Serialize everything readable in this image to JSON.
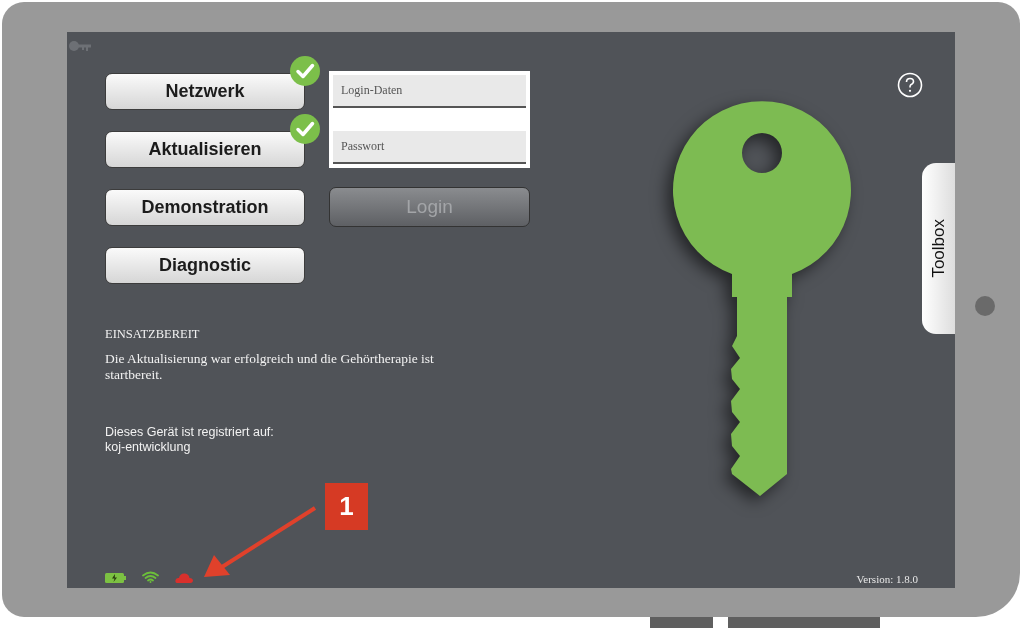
{
  "menu_buttons": [
    {
      "label": "Netzwerk",
      "checked": true
    },
    {
      "label": "Aktualisieren",
      "checked": true
    },
    {
      "label": "Demonstration",
      "checked": false
    },
    {
      "label": "Diagnostic",
      "checked": false
    }
  ],
  "login": {
    "fields": [
      {
        "placeholder": "Login-Daten"
      },
      {
        "placeholder": "Passwort"
      }
    ],
    "button": {
      "label": "Login",
      "disabled": true
    }
  },
  "status": {
    "title": "EINSATZBEREIT",
    "message": "Die Aktualisierung war erfolgreich und die Gehörtherapie ist startbereit."
  },
  "registration": {
    "label": "Dieses Gerät ist registriert auf:",
    "account": "koj-entwicklung"
  },
  "side_tab": {
    "label": "Toolbox"
  },
  "status_icons": [
    {
      "kind": "battery",
      "color": "#7cc142"
    },
    {
      "kind": "wifi",
      "color": "#6cbf3a"
    },
    {
      "kind": "cloud",
      "color": "#d9302c"
    }
  ],
  "version": "Version: 1.8.0",
  "annotation": {
    "label": "1"
  }
}
